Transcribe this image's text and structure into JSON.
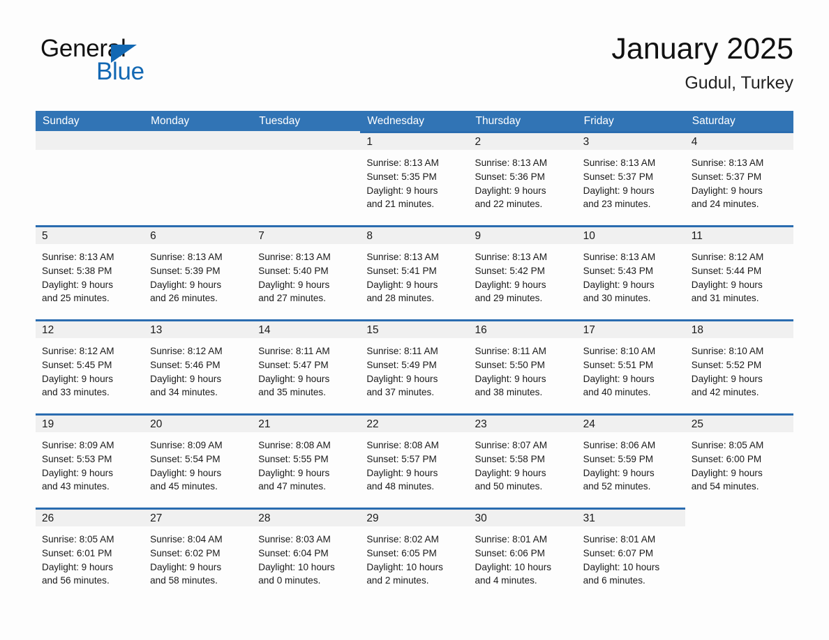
{
  "brand": {
    "name_part1": "General",
    "name_part2": "Blue",
    "triangle_icon": "triangle-icon",
    "accent_color": "#1268b3"
  },
  "header": {
    "month_title": "January 2025",
    "location": "Gudul, Turkey",
    "header_bg_color": "#3174b5",
    "row_divider_color": "#2a6cb0",
    "daynum_band_color": "#f0f0f0"
  },
  "weekday_headers": [
    "Sunday",
    "Monday",
    "Tuesday",
    "Wednesday",
    "Thursday",
    "Friday",
    "Saturday"
  ],
  "weeks": [
    [
      {
        "day": "",
        "state": "blank",
        "sunrise": "",
        "sunset": "",
        "daylight_line1": "",
        "daylight_line2": ""
      },
      {
        "day": "",
        "state": "blank",
        "sunrise": "",
        "sunset": "",
        "daylight_line1": "",
        "daylight_line2": ""
      },
      {
        "day": "",
        "state": "blank",
        "sunrise": "",
        "sunset": "",
        "daylight_line1": "",
        "daylight_line2": ""
      },
      {
        "day": "1",
        "state": "filled",
        "sunrise": "Sunrise: 8:13 AM",
        "sunset": "Sunset: 5:35 PM",
        "daylight_line1": "Daylight: 9 hours",
        "daylight_line2": "and 21 minutes."
      },
      {
        "day": "2",
        "state": "filled",
        "sunrise": "Sunrise: 8:13 AM",
        "sunset": "Sunset: 5:36 PM",
        "daylight_line1": "Daylight: 9 hours",
        "daylight_line2": "and 22 minutes."
      },
      {
        "day": "3",
        "state": "filled",
        "sunrise": "Sunrise: 8:13 AM",
        "sunset": "Sunset: 5:37 PM",
        "daylight_line1": "Daylight: 9 hours",
        "daylight_line2": "and 23 minutes."
      },
      {
        "day": "4",
        "state": "filled",
        "sunrise": "Sunrise: 8:13 AM",
        "sunset": "Sunset: 5:37 PM",
        "daylight_line1": "Daylight: 9 hours",
        "daylight_line2": "and 24 minutes."
      }
    ],
    [
      {
        "day": "5",
        "state": "filled",
        "sunrise": "Sunrise: 8:13 AM",
        "sunset": "Sunset: 5:38 PM",
        "daylight_line1": "Daylight: 9 hours",
        "daylight_line2": "and 25 minutes."
      },
      {
        "day": "6",
        "state": "filled",
        "sunrise": "Sunrise: 8:13 AM",
        "sunset": "Sunset: 5:39 PM",
        "daylight_line1": "Daylight: 9 hours",
        "daylight_line2": "and 26 minutes."
      },
      {
        "day": "7",
        "state": "filled",
        "sunrise": "Sunrise: 8:13 AM",
        "sunset": "Sunset: 5:40 PM",
        "daylight_line1": "Daylight: 9 hours",
        "daylight_line2": "and 27 minutes."
      },
      {
        "day": "8",
        "state": "filled",
        "sunrise": "Sunrise: 8:13 AM",
        "sunset": "Sunset: 5:41 PM",
        "daylight_line1": "Daylight: 9 hours",
        "daylight_line2": "and 28 minutes."
      },
      {
        "day": "9",
        "state": "filled",
        "sunrise": "Sunrise: 8:13 AM",
        "sunset": "Sunset: 5:42 PM",
        "daylight_line1": "Daylight: 9 hours",
        "daylight_line2": "and 29 minutes."
      },
      {
        "day": "10",
        "state": "filled",
        "sunrise": "Sunrise: 8:13 AM",
        "sunset": "Sunset: 5:43 PM",
        "daylight_line1": "Daylight: 9 hours",
        "daylight_line2": "and 30 minutes."
      },
      {
        "day": "11",
        "state": "filled",
        "sunrise": "Sunrise: 8:12 AM",
        "sunset": "Sunset: 5:44 PM",
        "daylight_line1": "Daylight: 9 hours",
        "daylight_line2": "and 31 minutes."
      }
    ],
    [
      {
        "day": "12",
        "state": "filled",
        "sunrise": "Sunrise: 8:12 AM",
        "sunset": "Sunset: 5:45 PM",
        "daylight_line1": "Daylight: 9 hours",
        "daylight_line2": "and 33 minutes."
      },
      {
        "day": "13",
        "state": "filled",
        "sunrise": "Sunrise: 8:12 AM",
        "sunset": "Sunset: 5:46 PM",
        "daylight_line1": "Daylight: 9 hours",
        "daylight_line2": "and 34 minutes."
      },
      {
        "day": "14",
        "state": "filled",
        "sunrise": "Sunrise: 8:11 AM",
        "sunset": "Sunset: 5:47 PM",
        "daylight_line1": "Daylight: 9 hours",
        "daylight_line2": "and 35 minutes."
      },
      {
        "day": "15",
        "state": "filled",
        "sunrise": "Sunrise: 8:11 AM",
        "sunset": "Sunset: 5:49 PM",
        "daylight_line1": "Daylight: 9 hours",
        "daylight_line2": "and 37 minutes."
      },
      {
        "day": "16",
        "state": "filled",
        "sunrise": "Sunrise: 8:11 AM",
        "sunset": "Sunset: 5:50 PM",
        "daylight_line1": "Daylight: 9 hours",
        "daylight_line2": "and 38 minutes."
      },
      {
        "day": "17",
        "state": "filled",
        "sunrise": "Sunrise: 8:10 AM",
        "sunset": "Sunset: 5:51 PM",
        "daylight_line1": "Daylight: 9 hours",
        "daylight_line2": "and 40 minutes."
      },
      {
        "day": "18",
        "state": "filled",
        "sunrise": "Sunrise: 8:10 AM",
        "sunset": "Sunset: 5:52 PM",
        "daylight_line1": "Daylight: 9 hours",
        "daylight_line2": "and 42 minutes."
      }
    ],
    [
      {
        "day": "19",
        "state": "filled",
        "sunrise": "Sunrise: 8:09 AM",
        "sunset": "Sunset: 5:53 PM",
        "daylight_line1": "Daylight: 9 hours",
        "daylight_line2": "and 43 minutes."
      },
      {
        "day": "20",
        "state": "filled",
        "sunrise": "Sunrise: 8:09 AM",
        "sunset": "Sunset: 5:54 PM",
        "daylight_line1": "Daylight: 9 hours",
        "daylight_line2": "and 45 minutes."
      },
      {
        "day": "21",
        "state": "filled",
        "sunrise": "Sunrise: 8:08 AM",
        "sunset": "Sunset: 5:55 PM",
        "daylight_line1": "Daylight: 9 hours",
        "daylight_line2": "and 47 minutes."
      },
      {
        "day": "22",
        "state": "filled",
        "sunrise": "Sunrise: 8:08 AM",
        "sunset": "Sunset: 5:57 PM",
        "daylight_line1": "Daylight: 9 hours",
        "daylight_line2": "and 48 minutes."
      },
      {
        "day": "23",
        "state": "filled",
        "sunrise": "Sunrise: 8:07 AM",
        "sunset": "Sunset: 5:58 PM",
        "daylight_line1": "Daylight: 9 hours",
        "daylight_line2": "and 50 minutes."
      },
      {
        "day": "24",
        "state": "filled",
        "sunrise": "Sunrise: 8:06 AM",
        "sunset": "Sunset: 5:59 PM",
        "daylight_line1": "Daylight: 9 hours",
        "daylight_line2": "and 52 minutes."
      },
      {
        "day": "25",
        "state": "filled",
        "sunrise": "Sunrise: 8:05 AM",
        "sunset": "Sunset: 6:00 PM",
        "daylight_line1": "Daylight: 9 hours",
        "daylight_line2": "and 54 minutes."
      }
    ],
    [
      {
        "day": "26",
        "state": "filled",
        "sunrise": "Sunrise: 8:05 AM",
        "sunset": "Sunset: 6:01 PM",
        "daylight_line1": "Daylight: 9 hours",
        "daylight_line2": "and 56 minutes."
      },
      {
        "day": "27",
        "state": "filled",
        "sunrise": "Sunrise: 8:04 AM",
        "sunset": "Sunset: 6:02 PM",
        "daylight_line1": "Daylight: 9 hours",
        "daylight_line2": "and 58 minutes."
      },
      {
        "day": "28",
        "state": "filled",
        "sunrise": "Sunrise: 8:03 AM",
        "sunset": "Sunset: 6:04 PM",
        "daylight_line1": "Daylight: 10 hours",
        "daylight_line2": "and 0 minutes."
      },
      {
        "day": "29",
        "state": "filled",
        "sunrise": "Sunrise: 8:02 AM",
        "sunset": "Sunset: 6:05 PM",
        "daylight_line1": "Daylight: 10 hours",
        "daylight_line2": "and 2 minutes."
      },
      {
        "day": "30",
        "state": "filled",
        "sunrise": "Sunrise: 8:01 AM",
        "sunset": "Sunset: 6:06 PM",
        "daylight_line1": "Daylight: 10 hours",
        "daylight_line2": "and 4 minutes."
      },
      {
        "day": "31",
        "state": "filled",
        "sunrise": "Sunrise: 8:01 AM",
        "sunset": "Sunset: 6:07 PM",
        "daylight_line1": "Daylight: 10 hours",
        "daylight_line2": "and 6 minutes."
      },
      {
        "day": "",
        "state": "blank",
        "sunrise": "",
        "sunset": "",
        "daylight_line1": "",
        "daylight_line2": ""
      }
    ]
  ]
}
